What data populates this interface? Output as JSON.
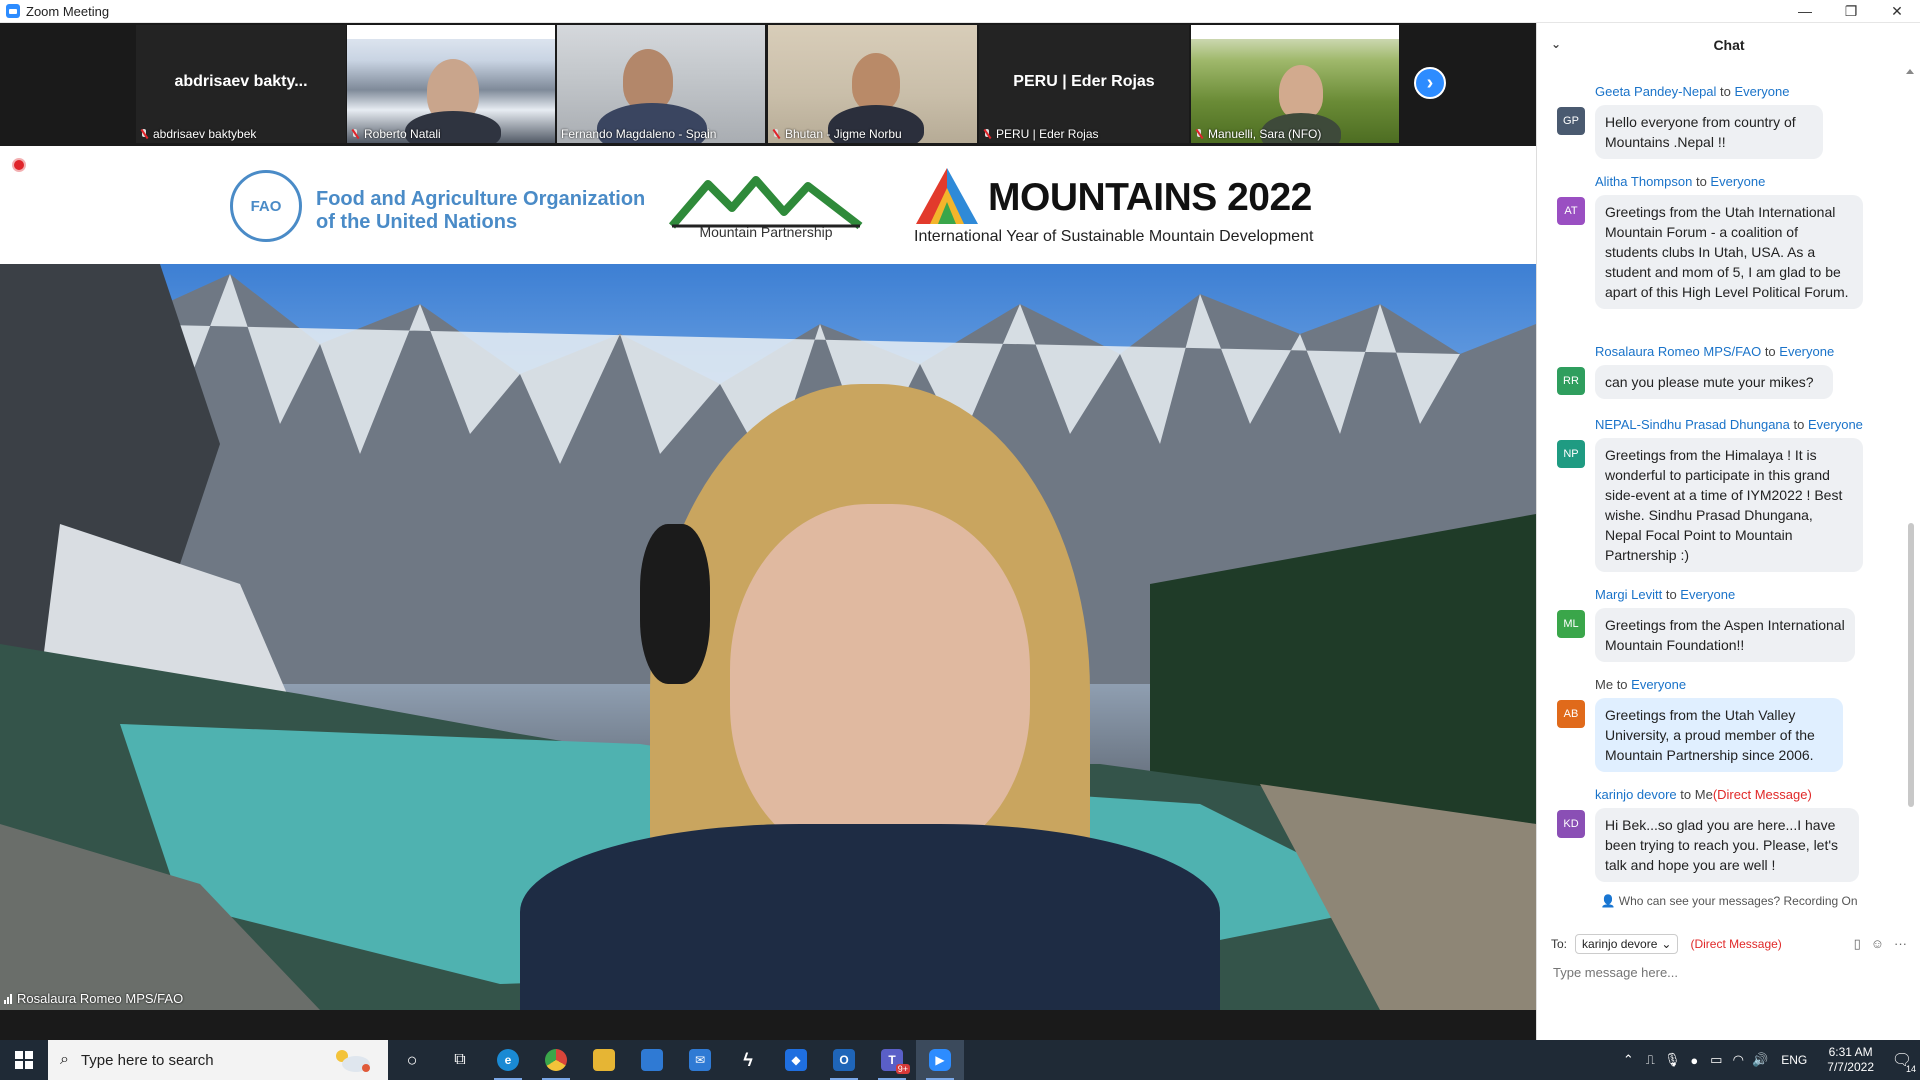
{
  "window": {
    "title": "Zoom Meeting",
    "controls": [
      "—",
      "❐",
      "✕"
    ]
  },
  "participants": [
    {
      "display": "abdrisaev  bakty...",
      "label": "abdrisaev  baktybek",
      "video": false
    },
    {
      "label": "Roberto Natali",
      "video": true,
      "scene": "snow"
    },
    {
      "label": "Fernando Magdaleno - Spain",
      "video": true,
      "scene": "office"
    },
    {
      "label": "Bhutan - Jigme Norbu",
      "video": true,
      "scene": "beige"
    },
    {
      "display": "PERU | Eder Rojas",
      "label": "PERU | Eder Rojas",
      "video": false
    },
    {
      "label": "Manuelli, Sara (NFO)",
      "video": true,
      "scene": "terrace"
    }
  ],
  "next_page_icon": "chevron-right-icon",
  "main_video": {
    "speaker": "Rosalaura Romeo MPS/FAO",
    "banner": {
      "fao_mark": "FAO",
      "fao_line1": "Food and Agriculture Organization",
      "fao_line2": "of the United Nations",
      "mp_text": "Mountain Partnership",
      "m22_title": "MOUNTAINS 2022",
      "m22_subtitle": "International Year of Sustainable Mountain Development"
    }
  },
  "chat": {
    "title": "Chat",
    "messages": [
      {
        "initials": "GP",
        "color": "#4a5a70",
        "sender": "Geeta Pandey-Nepal",
        "to": "to",
        "recipient": "Everyone",
        "dm": "",
        "text": "Hello everyone from country of Mountains .Nepal !!",
        "me": false
      },
      {
        "initials": "AT",
        "color": "#9a4fc2",
        "sender": "Alitha Thompson",
        "to": "to",
        "recipient": "Everyone",
        "dm": "",
        "text": "Greetings from the Utah International Mountain Forum - a coalition of students clubs In Utah, USA. As a student and mom of 5, I am glad to be apart of this High Level Political Forum.",
        "me": false
      },
      {
        "initials": "RR",
        "color": "#2f9e5e",
        "sender": "Rosalaura Romeo MPS/FAO",
        "to": "to",
        "recipient": "Everyone",
        "dm": "",
        "text": "can you please mute your mikes?",
        "me": false
      },
      {
        "initials": "NP",
        "color": "#1f9b82",
        "sender": "NEPAL-Sindhu Prasad Dhungana",
        "to": "to",
        "recipient": "Everyone",
        "dm": "",
        "text": "Greetings from the Himalaya ! It is wonderful to participate in this grand side-event at a time of IYM2022 ! Best wishe. Sindhu Prasad Dhungana, Nepal Focal Point to Mountain Partnership :)",
        "me": false
      },
      {
        "initials": "ML",
        "color": "#3aa64a",
        "sender": "Margi Levitt",
        "to": "to",
        "recipient": "Everyone",
        "dm": "",
        "text": "Greetings from the Aspen International Mountain Foundation!!",
        "me": false
      },
      {
        "initials": "AB",
        "color": "#e06a1b",
        "sender": "Me",
        "to": "to",
        "recipient": "Everyone",
        "dm": "",
        "text": "Greetings from the Utah Valley University, a proud member of the Mountain Partnership since 2006.",
        "me": true
      },
      {
        "initials": "KD",
        "color": "#8a4fb5",
        "sender": "karinjo devore",
        "to": "to",
        "recipient": "Me",
        "dm": "(Direct Message)",
        "text": "Hi Bek...so glad you are here...I have been trying to reach you. Please, let's talk and hope you are well !",
        "me": false
      }
    ],
    "notice": "Who can see your messages? Recording On",
    "to_label": "To:",
    "to_value": "karinjo devore",
    "to_dm": "(Direct Message)",
    "input_placeholder": "Type message here..."
  },
  "taskbar": {
    "search_placeholder": "Type here to search",
    "apps": [
      {
        "name": "cortana-icon",
        "glyph": "○",
        "color": "transparent"
      },
      {
        "name": "task-view-icon",
        "glyph": "⧉",
        "color": "transparent"
      },
      {
        "name": "edge-icon",
        "glyph": "e",
        "color": "#1a8ad4"
      },
      {
        "name": "chrome-icon",
        "glyph": "●",
        "color": "#d8453a"
      },
      {
        "name": "file-explorer-icon",
        "glyph": "▭",
        "color": "#e6b534"
      },
      {
        "name": "store-icon",
        "glyph": "▦",
        "color": "#2f7ad4"
      },
      {
        "name": "mail-icon",
        "glyph": "✉",
        "color": "#2f7ad4"
      },
      {
        "name": "winamp-icon",
        "glyph": "ϟ",
        "color": "transparent"
      },
      {
        "name": "dropbox-icon",
        "glyph": "◆",
        "color": "#1f6fe0"
      },
      {
        "name": "outlook-icon",
        "glyph": "O",
        "color": "#1f65b8"
      },
      {
        "name": "teams-icon",
        "glyph": "T",
        "color": "#5a5fc7"
      },
      {
        "name": "zoom-icon",
        "glyph": "▶",
        "color": "#2d8cff"
      }
    ],
    "teams_badge": "9+",
    "tray": {
      "language": "ENG",
      "time": "6:31 AM",
      "date": "7/7/2022",
      "notifications": "14"
    }
  }
}
